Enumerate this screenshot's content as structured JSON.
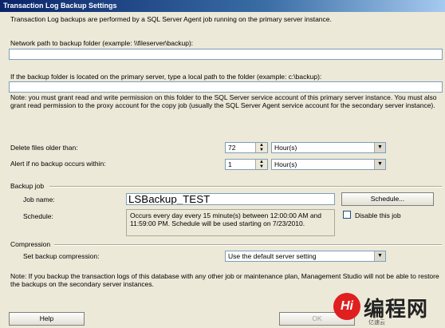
{
  "window": {
    "title": "Transaction Log Backup Settings"
  },
  "intro": "Transaction Log backups are performed by a SQL Server Agent job running on the primary server instance.",
  "network_path": {
    "label": "Network path to backup folder (example: \\\\fileserver\\backup):",
    "value": ""
  },
  "local_path": {
    "label": "If the backup folder is located on the primary server, type a local path to the folder (example: c:\\backup):",
    "value": ""
  },
  "permission_note": "Note: you must grant read and write permission on this folder to the SQL Server service account of this primary server instance. You must also grant read permission to the proxy account for the copy job (usually the SQL Server Agent service account for the secondary server instance).",
  "delete_files": {
    "label": "Delete files older than:",
    "value": "72",
    "unit": "Hour(s)"
  },
  "alert": {
    "label": "Alert if no backup occurs within:",
    "value": "1",
    "unit": "Hour(s)"
  },
  "backup_job": {
    "group_label": "Backup job",
    "job_name_label": "Job name:",
    "job_name_value": "LSBackup_TEST",
    "schedule_button": "Schedule...",
    "schedule_label": "Schedule:",
    "schedule_text": "Occurs every day every 15 minute(s) between 12:00:00 AM and 11:59:00 PM. Schedule will be used starting on 7/23/2010.",
    "disable_label": "Disable this job",
    "disable_checked": false
  },
  "compression": {
    "group_label": "Compression",
    "label": "Set backup compression:",
    "value": "Use the default server setting"
  },
  "footer_note": "Note: If you backup the transaction logs of this database with any other job or maintenance plan, Management Studio will not be able to restore the backups on the secondary server instances.",
  "buttons": {
    "help": "Help",
    "ok": "OK"
  },
  "watermark": {
    "badge": "Hi",
    "text": "编程网",
    "small": "亿速云"
  }
}
